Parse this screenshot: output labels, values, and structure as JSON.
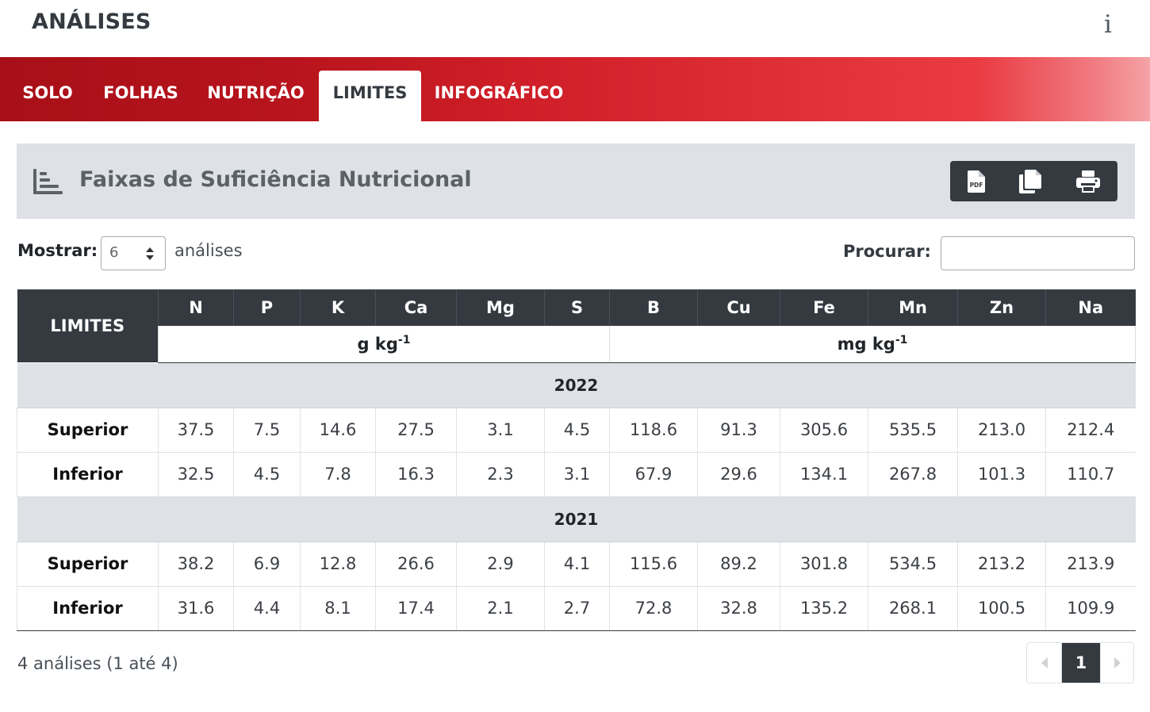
{
  "app": {
    "title": "ANÁLISES",
    "info_label": "i"
  },
  "tabs": [
    {
      "label": "SOLO",
      "active": false
    },
    {
      "label": "FOLHAS",
      "active": false
    },
    {
      "label": "NUTRIÇÃO",
      "active": false
    },
    {
      "label": "LIMITES",
      "active": true
    },
    {
      "label": "INFOGRÁFICO",
      "active": false
    }
  ],
  "card": {
    "title": "Faixas de Suficiência Nutricional",
    "icon": "chart-bar-icon",
    "buttons": [
      {
        "name": "pdf-export",
        "icon": "file-pdf-icon",
        "text": "PDF"
      },
      {
        "name": "copy",
        "icon": "copy-icon"
      },
      {
        "name": "print",
        "icon": "print-icon"
      }
    ]
  },
  "controls": {
    "show_label": "Mostrar:",
    "page_size": "6",
    "show_suffix": "análises",
    "search_label": "Procurar:",
    "search_value": ""
  },
  "table": {
    "corner_label": "LIMITES",
    "columns": [
      "N",
      "P",
      "K",
      "Ca",
      "Mg",
      "S",
      "B",
      "Cu",
      "Fe",
      "Mn",
      "Zn",
      "Na"
    ],
    "unit_groups": [
      {
        "base": "g kg",
        "exp": "-1"
      },
      {
        "base": "mg kg",
        "exp": "-1"
      }
    ],
    "groups": [
      {
        "year": "2022",
        "rows": [
          {
            "label": "Superior",
            "values": [
              "37.5",
              "7.5",
              "14.6",
              "27.5",
              "3.1",
              "4.5",
              "118.6",
              "91.3",
              "305.6",
              "535.5",
              "213.0",
              "212.4"
            ]
          },
          {
            "label": "Inferior",
            "values": [
              "32.5",
              "4.5",
              "7.8",
              "16.3",
              "2.3",
              "3.1",
              "67.9",
              "29.6",
              "134.1",
              "267.8",
              "101.3",
              "110.7"
            ]
          }
        ]
      },
      {
        "year": "2021",
        "rows": [
          {
            "label": "Superior",
            "values": [
              "38.2",
              "6.9",
              "12.8",
              "26.6",
              "2.9",
              "4.1",
              "115.6",
              "89.2",
              "301.8",
              "534.5",
              "213.2",
              "213.9"
            ]
          },
          {
            "label": "Inferior",
            "values": [
              "31.6",
              "4.4",
              "8.1",
              "17.4",
              "2.1",
              "2.7",
              "72.8",
              "32.8",
              "135.2",
              "268.1",
              "100.5",
              "109.9"
            ]
          }
        ]
      }
    ]
  },
  "footer": {
    "info": "4 análises (1 até 4)"
  },
  "pagination": {
    "current": "1"
  },
  "colors": {
    "accent_dark": "#343a40",
    "tab_red": "#c41a22",
    "header_gray": "#dee2e6"
  }
}
